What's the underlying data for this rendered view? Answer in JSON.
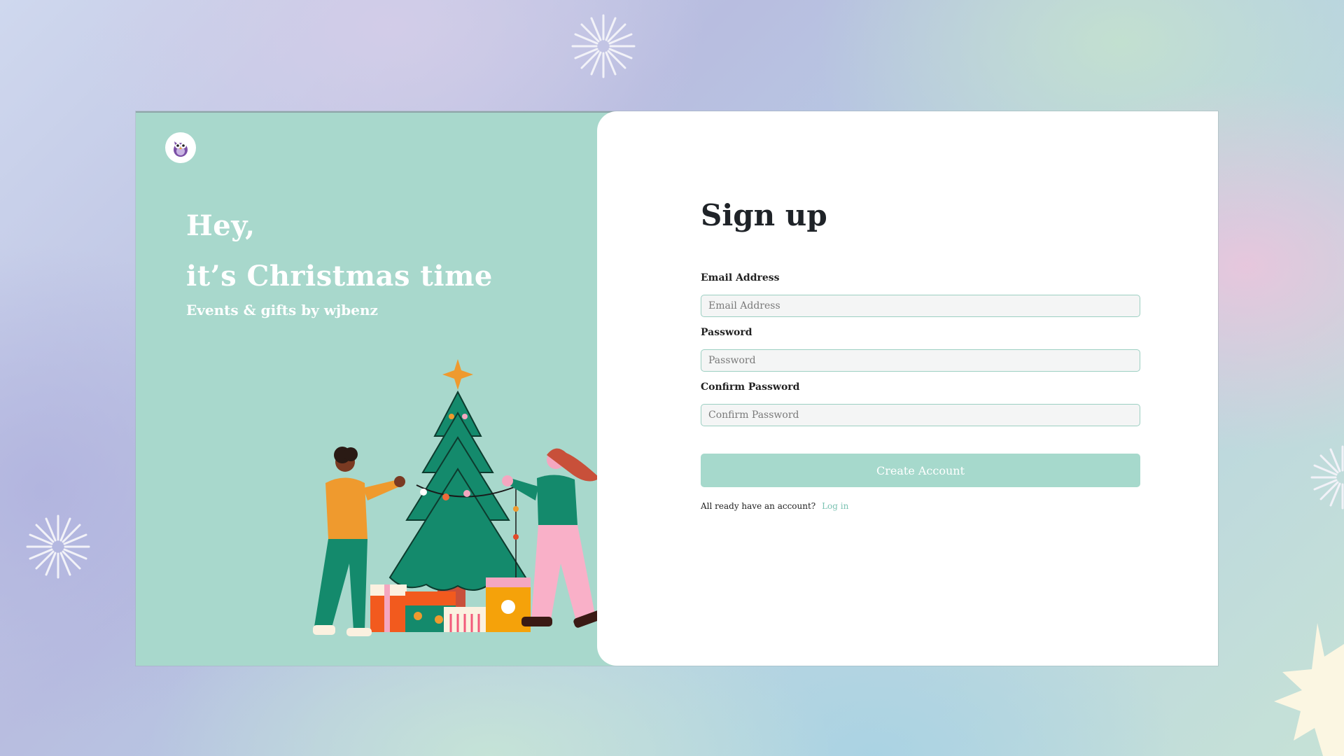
{
  "hero": {
    "line1": "Hey,",
    "line2": "it’s Christmas time",
    "subtitle": "Events & gifts by wjbenz",
    "logo_icon": "owl-mascot-icon"
  },
  "signup": {
    "title": "Sign up",
    "email": {
      "label": "Email Address",
      "placeholder": "Email Address",
      "value": ""
    },
    "password": {
      "label": "Password",
      "placeholder": "Password",
      "value": ""
    },
    "confirm": {
      "label": "Confirm Password",
      "placeholder": "Confirm Password",
      "value": ""
    },
    "submit_label": "Create Account",
    "login_prompt": "All ready have an account?",
    "login_link": "Log in"
  },
  "colors": {
    "panel_mint": "#a8d8cc",
    "button_mint": "#a6d9cc",
    "link": "#7cc3b3",
    "tree_green": "#148a6c",
    "card_white": "#ffffff"
  },
  "decor": {
    "illustration": "christmas-tree-with-two-people-and-gifts",
    "sparkles": [
      "sparkle-top",
      "sparkle-left",
      "sparkle-right",
      "star-burst-bottom-right"
    ]
  }
}
